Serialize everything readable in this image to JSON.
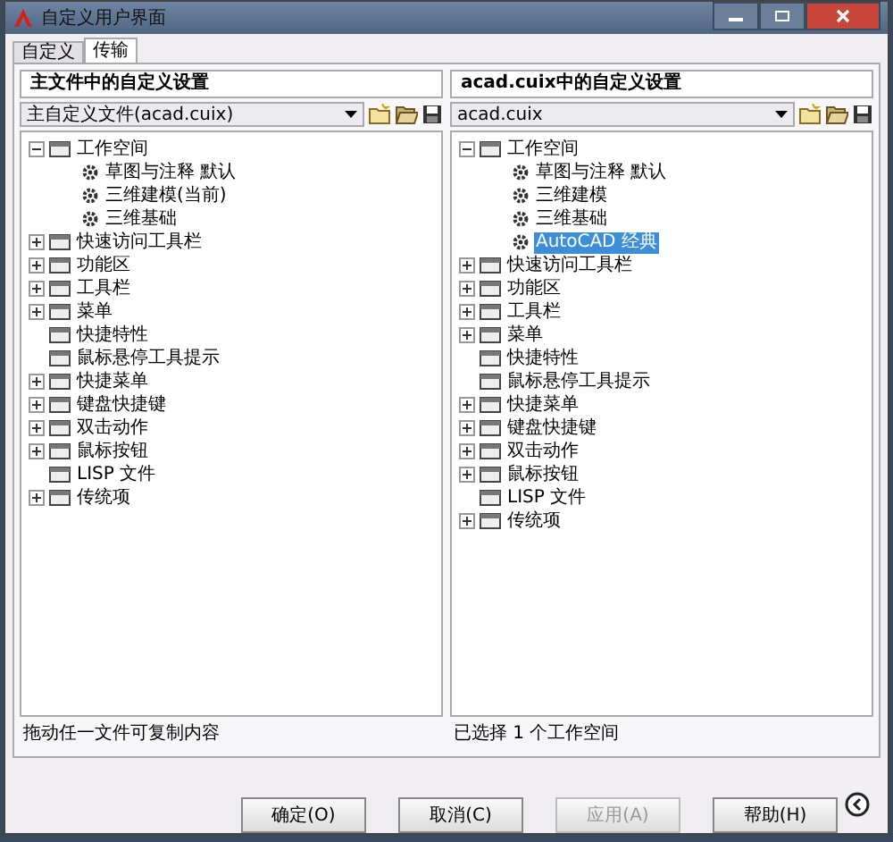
{
  "window": {
    "title": "自定义用户界面"
  },
  "tabs": [
    {
      "label": "自定义",
      "selected": false
    },
    {
      "label": "传输",
      "selected": true
    }
  ],
  "panels": [
    {
      "header": "主文件中的自定义设置",
      "file": "主自定义文件(acad.cuix)",
      "tree": [
        {
          "label": "工作空间",
          "expanded": true,
          "selected": false,
          "children": [
            {
              "label": "草图与注释 默认",
              "selected": false
            },
            {
              "label": "三维建模(当前)",
              "selected": false
            },
            {
              "label": "三维基础",
              "selected": false
            }
          ]
        },
        {
          "label": "快速访问工具栏",
          "expanded": false,
          "selected": false
        },
        {
          "label": "功能区",
          "expanded": false,
          "selected": false
        },
        {
          "label": "工具栏",
          "expanded": false,
          "selected": false
        },
        {
          "label": "菜单",
          "expanded": false,
          "selected": false
        },
        {
          "label": "快捷特性",
          "selected": false
        },
        {
          "label": "鼠标悬停工具提示",
          "selected": false
        },
        {
          "label": "快捷菜单",
          "expanded": false,
          "selected": false
        },
        {
          "label": "键盘快捷键",
          "expanded": false,
          "selected": false
        },
        {
          "label": "双击动作",
          "expanded": false,
          "selected": false
        },
        {
          "label": "鼠标按钮",
          "expanded": false,
          "selected": false
        },
        {
          "label": "LISP 文件",
          "selected": false
        },
        {
          "label": "传统项",
          "expanded": false,
          "selected": false
        }
      ],
      "status": "拖动任一文件可复制内容"
    },
    {
      "header": "acad.cuix中的自定义设置",
      "file": "acad.cuix",
      "tree": [
        {
          "label": "工作空间",
          "expanded": true,
          "selected": false,
          "children": [
            {
              "label": "草图与注释 默认",
              "selected": false
            },
            {
              "label": "三维建模",
              "selected": false
            },
            {
              "label": "三维基础",
              "selected": false
            },
            {
              "label": "AutoCAD 经典",
              "selected": true
            }
          ]
        },
        {
          "label": "快速访问工具栏",
          "expanded": false,
          "selected": false
        },
        {
          "label": "功能区",
          "expanded": false,
          "selected": false
        },
        {
          "label": "工具栏",
          "expanded": false,
          "selected": false
        },
        {
          "label": "菜单",
          "expanded": false,
          "selected": false
        },
        {
          "label": "快捷特性",
          "selected": false
        },
        {
          "label": "鼠标悬停工具提示",
          "selected": false
        },
        {
          "label": "快捷菜单",
          "expanded": false,
          "selected": false
        },
        {
          "label": "键盘快捷键",
          "expanded": false,
          "selected": false
        },
        {
          "label": "双击动作",
          "expanded": false,
          "selected": false
        },
        {
          "label": "鼠标按钮",
          "expanded": false,
          "selected": false
        },
        {
          "label": "LISP 文件",
          "selected": false
        },
        {
          "label": "传统项",
          "expanded": false,
          "selected": false
        }
      ],
      "status": "已选择 1 个工作空间"
    }
  ],
  "buttons": [
    {
      "label": "确定(O)",
      "disabled": false
    },
    {
      "label": "取消(C)",
      "disabled": false
    },
    {
      "label": "应用(A)",
      "disabled": true
    },
    {
      "label": "帮助(H)",
      "disabled": false
    }
  ]
}
